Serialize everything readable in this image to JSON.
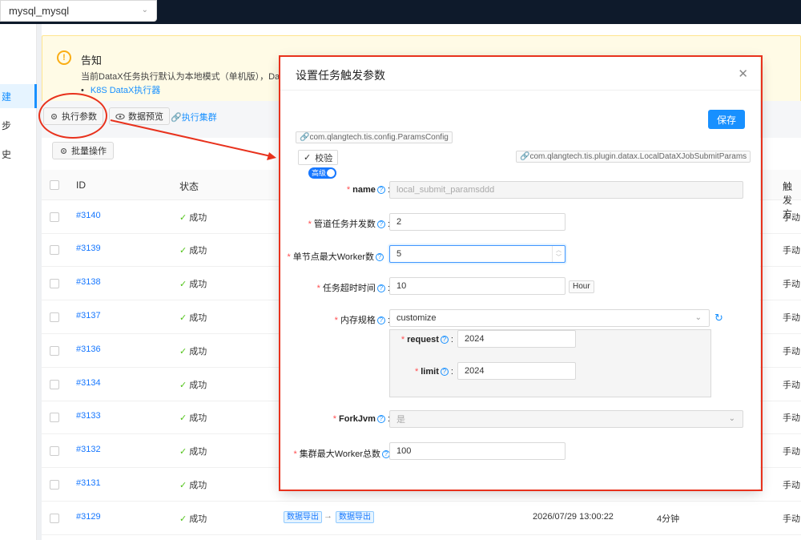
{
  "topbar": {
    "datasource_value": "mysql_mysql"
  },
  "leftmenu": {
    "items": [
      "建",
      "步",
      "史"
    ]
  },
  "notice": {
    "title": "告知",
    "text": "当前DataX任务执行默认为本地模式（单机版），DataX",
    "link": "K8S DataX执行器"
  },
  "toolbar": {
    "exec_params": "执行参数",
    "data_preview": "数据预览",
    "exec_cluster": "执行集群",
    "batch_ops": "批量操作"
  },
  "table": {
    "headers": {
      "id": "ID",
      "status": "状态",
      "trigger": "触发方"
    },
    "rows": [
      {
        "id": "#3140",
        "status": "成功",
        "trigger": "手动"
      },
      {
        "id": "#3139",
        "status": "成功",
        "trigger": "手动"
      },
      {
        "id": "#3138",
        "status": "成功",
        "trigger": "手动"
      },
      {
        "id": "#3137",
        "status": "成功",
        "trigger": "手动"
      },
      {
        "id": "#3136",
        "status": "成功",
        "trigger": "手动"
      },
      {
        "id": "#3134",
        "status": "成功",
        "trigger": "手动"
      },
      {
        "id": "#3133",
        "status": "成功",
        "trigger": "手动"
      },
      {
        "id": "#3132",
        "status": "成功",
        "trigger": "手动"
      },
      {
        "id": "#3131",
        "status": "成功",
        "trigger": "手动"
      },
      {
        "id": "#3129",
        "status": "成功",
        "trigger": "手动",
        "tag1": "数据导出",
        "tag2": "数据导出",
        "time": "2026/07/29 13:00:22",
        "duration": "4分钟"
      }
    ]
  },
  "modal": {
    "title": "设置任务触发参数",
    "save": "保存",
    "params_plugin": "com.qlangtech.tis.config.ParamsConfig",
    "job_plugin": "com.qlangtech.tis.plugin.datax.LocalDataXJobSubmitParams",
    "verify": "校验",
    "advanced": "高级",
    "fields": {
      "name": {
        "label": "name",
        "placeholder": "local_submit_paramsddd"
      },
      "pipeline_concurrency": {
        "label": "管道任务并发数",
        "value": "2"
      },
      "max_worker_single": {
        "label": "单节点最大Worker数",
        "value": "5"
      },
      "task_timeout": {
        "label": "任务超时时间",
        "value": "10",
        "unit": "Hour"
      },
      "memory_spec": {
        "label": "内存规格",
        "value": "customize"
      },
      "request": {
        "label": "request",
        "value": "2024"
      },
      "limit": {
        "label": "limit",
        "value": "2024"
      },
      "fork_jvm": {
        "label": "ForkJvm",
        "value": "是"
      },
      "cluster_max_worker": {
        "label": "集群最大Worker总数",
        "value": "100"
      }
    }
  },
  "colors": {
    "accent": "#1890ff",
    "annotation": "#e8321d",
    "success": "#52c41a"
  }
}
